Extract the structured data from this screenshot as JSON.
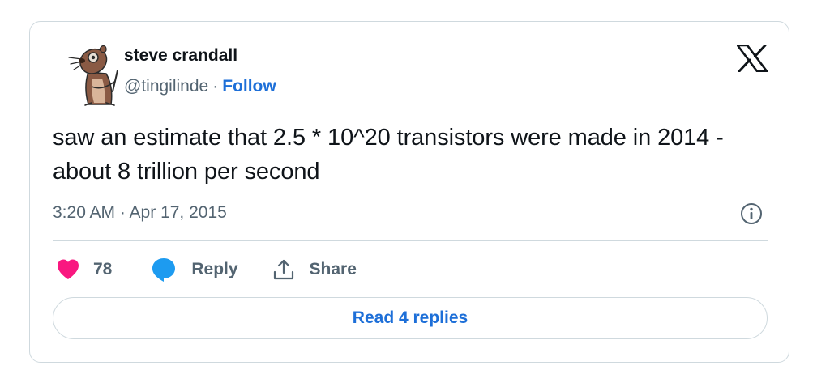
{
  "author": {
    "name": "steve crandall",
    "handle": "@tingilinde",
    "separator": "·",
    "follow_label": "Follow",
    "avatar_icon": "cartoon-ferret-avatar"
  },
  "header": {
    "logo_icon": "x-logo-icon"
  },
  "tweet": {
    "text": "saw an estimate that 2.5 * 10^20 transistors were made in 2014 - about 8 trillion per second",
    "timestamp": "3:20 AM · Apr 17, 2015"
  },
  "actions": {
    "like_count": "78",
    "reply_label": "Reply",
    "share_label": "Share",
    "like_icon": "heart-icon",
    "reply_icon": "speech-bubble-icon",
    "share_icon": "share-upload-icon",
    "info_icon": "info-icon"
  },
  "footer": {
    "read_replies_label": "Read 4 replies"
  },
  "colors": {
    "accent": "#1d6fd8",
    "like": "#f91880",
    "reply": "#1d9bf0",
    "muted_text": "#536471",
    "border": "#cfd9de"
  }
}
